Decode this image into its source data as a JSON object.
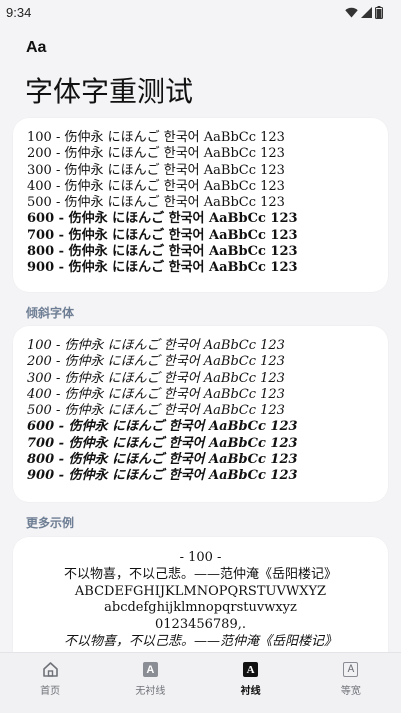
{
  "status_bar": {
    "time": "9:34"
  },
  "app_bar": {
    "icon_text": "Aa"
  },
  "page": {
    "title": "字体字重测试"
  },
  "weight_rows": [
    {
      "label": "100 - 伤仲永 にほんご 한국어 AaBbCc 123",
      "weight": 100
    },
    {
      "label": "200 - 伤仲永 にほんご 한국어 AaBbCc 123",
      "weight": 200
    },
    {
      "label": "300 - 伤仲永 にほんご 한국어 AaBbCc 123",
      "weight": 300
    },
    {
      "label": "400 - 伤仲永 にほんご 한국어 AaBbCc 123",
      "weight": 400
    },
    {
      "label": "500 - 伤仲永 にほんご 한국어 AaBbCc 123",
      "weight": 500
    },
    {
      "label": "600 - 伤仲永 にほんご 한국어 AaBbCc 123",
      "weight": 600
    },
    {
      "label": "700 - 伤仲永 にほんご 한국어 AaBbCc 123",
      "weight": 700
    },
    {
      "label": "800 - 伤仲永 にほんご 한국어 AaBbCc 123",
      "weight": 800
    },
    {
      "label": "900 - 伤仲永 にほんご 한국어 AaBbCc 123",
      "weight": 900
    }
  ],
  "italic_section": {
    "label": "倾斜字体"
  },
  "italic_rows": [
    {
      "label": "100 - 伤仲永 にほんご 한국어 AaBbCc 123",
      "weight": 100
    },
    {
      "label": "200 - 伤仲永 にほんご 한국어 AaBbCc 123",
      "weight": 200
    },
    {
      "label": "300 - 伤仲永 にほんご 한국어 AaBbCc 123",
      "weight": 300
    },
    {
      "label": "400 - 伤仲永 にほんご 한국어 AaBbCc 123",
      "weight": 400
    },
    {
      "label": "500 - 伤仲永 にほんご 한국어 AaBbCc 123",
      "weight": 500
    },
    {
      "label": "600 - 伤仲永 にほんご 한국어 AaBbCc 123",
      "weight": 600
    },
    {
      "label": "700 - 伤仲永 にほんご 한국어 AaBbCc 123",
      "weight": 700
    },
    {
      "label": "800 - 伤仲永 にほんご 한국어 AaBbCc 123",
      "weight": 800
    },
    {
      "label": "900 - 伤仲永 にほんご 한국어 AaBbCc 123",
      "weight": 900
    }
  ],
  "more_section": {
    "label": "更多示例",
    "heading": "- 100 -",
    "line1": "不以物喜，不以己悲。——范仲淹《岳阳楼记》",
    "line2": "ABCDEFGHIJKLMNOPQRSTUVWXYZ",
    "line3": "abcdefghijklmnopqrstuvwxyz",
    "line4": "0123456789,.",
    "line5": "不以物喜，不以己悲。——范仲淹《岳阳楼记》"
  },
  "bottom_nav": {
    "items": [
      {
        "label": "首页",
        "icon": "home-icon",
        "active": false
      },
      {
        "label": "无衬线",
        "icon": "sans-serif-icon",
        "active": false
      },
      {
        "label": "衬线",
        "icon": "serif-icon",
        "active": true
      },
      {
        "label": "等宽",
        "icon": "monospace-icon",
        "active": false
      }
    ]
  },
  "colors": {
    "background": "#f4f4f6",
    "card": "#ffffff",
    "section_label": "#6e7e94",
    "nav_inactive": "#6f7278",
    "nav_active": "#111111"
  }
}
